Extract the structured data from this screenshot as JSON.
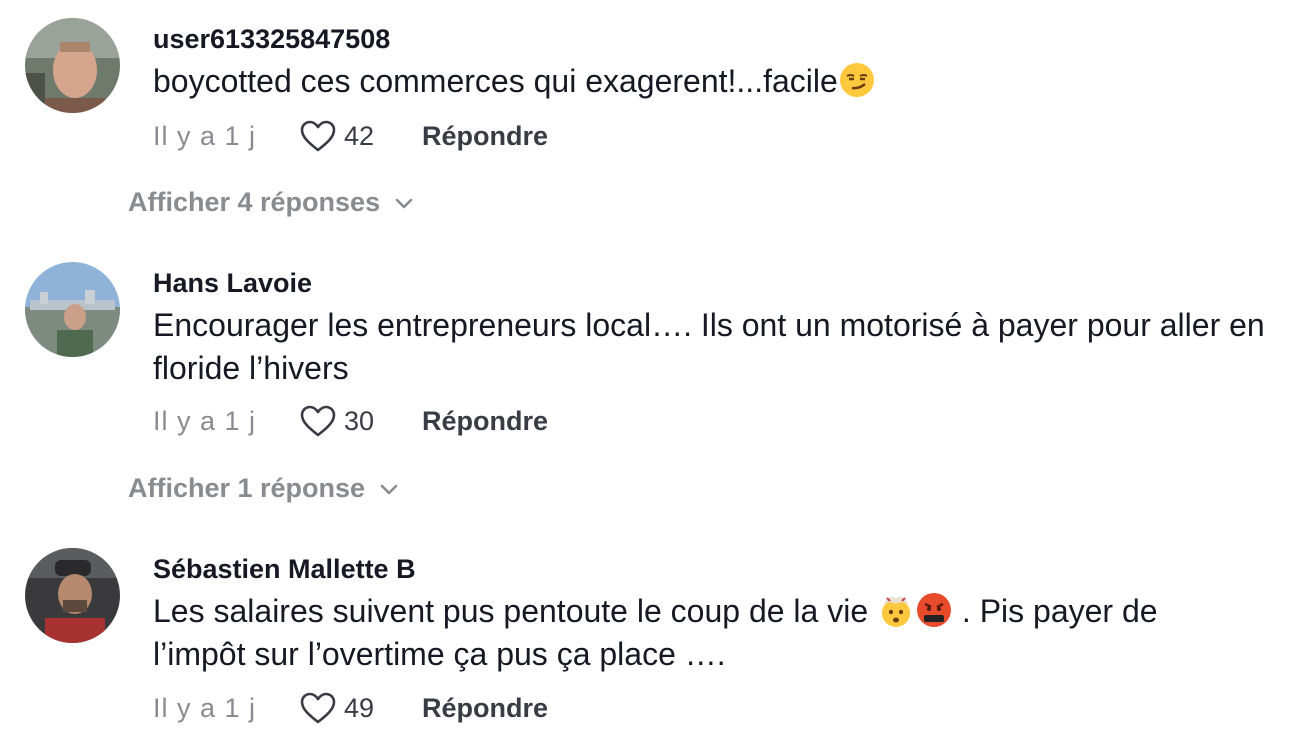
{
  "comments": [
    {
      "username": "user613325847508",
      "text": "boycotted ces commerces qui exagerent!...facile",
      "emoji_after": [
        "smirk-emoji"
      ],
      "time": "Il y a 1 j",
      "likes": "42",
      "reply_label": "Répondre",
      "view_replies": "Afficher 4 réponses"
    },
    {
      "username": "Hans Lavoie",
      "text": "Encourager les entrepreneurs local…. Ils ont un motorisé à payer pour aller en floride l’hivers",
      "time": "Il y a 1 j",
      "likes": "30",
      "reply_label": "Répondre",
      "view_replies": "Afficher 1 réponse"
    },
    {
      "username": "Sébastien Mallette B",
      "text_part1": "Les salaires suivent pus pentoute le coup de la vie ",
      "emojis": [
        "exploding-head-emoji",
        "cursing-face-emoji"
      ],
      "text_part2": " . Pis payer de l’impôt sur l’overtime ça pus ça place ….",
      "time": "Il y a 1 j",
      "likes": "49",
      "reply_label": "Répondre"
    }
  ],
  "icons": {
    "like": "heart-outline-icon",
    "expand": "chevron-down-icon"
  },
  "colors": {
    "primary_text": "#161823",
    "secondary_text": "#8a8b91",
    "action_text": "#3a3b45"
  }
}
